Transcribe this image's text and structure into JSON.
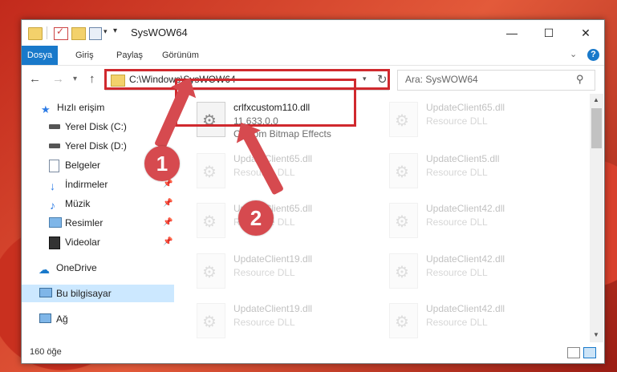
{
  "window": {
    "title": "SysWOW64",
    "min": "—",
    "max": "☐",
    "close": "✕"
  },
  "colors": {
    "accent": "#1979ca",
    "highlight": "#d0292e",
    "arrow": "#d64a4f",
    "selected": "#cce8ff"
  },
  "ribbon": {
    "tabs": [
      "Dosya",
      "Giriş",
      "Paylaş",
      "Görünüm"
    ],
    "help": "?"
  },
  "address": {
    "path": "C:\\Windows\\SysWOW64",
    "search_placeholder": "Ara: SysWOW64"
  },
  "nav": {
    "items": [
      {
        "label": "Hızlı erişim",
        "icon": "star-icon"
      },
      {
        "label": "Yerel Disk (C:)",
        "icon": "drive-icon"
      },
      {
        "label": "Yerel Disk (D:)",
        "icon": "drive-icon"
      },
      {
        "label": "Belgeler",
        "icon": "documents-icon"
      },
      {
        "label": "İndirmeler",
        "icon": "download-icon"
      },
      {
        "label": "Müzik",
        "icon": "music-icon"
      },
      {
        "label": "Resimler",
        "icon": "pictures-icon"
      },
      {
        "label": "Videolar",
        "icon": "video-icon"
      },
      {
        "label": "OneDrive",
        "icon": "cloud-icon"
      },
      {
        "label": "Bu bilgisayar",
        "icon": "computer-icon"
      },
      {
        "label": "Ağ",
        "icon": "network-icon"
      }
    ]
  },
  "files": {
    "highlighted": {
      "name": "crlfxcustom110.dll",
      "version": "11.633.0.0",
      "desc": "Custom Bitmap Effects"
    },
    "left": [
      {
        "name": "UpdateClient65.dll",
        "desc": "Resource DLL"
      },
      {
        "name": "UpdateClient65.dll",
        "desc": "Resource DLL"
      },
      {
        "name": "UpdateClient19.dll",
        "desc": "Resource DLL"
      },
      {
        "name": "UpdateClient19.dll",
        "desc": "Resource DLL"
      }
    ],
    "right": [
      {
        "name": "UpdateClient65.dll",
        "desc": "Resource DLL"
      },
      {
        "name": "UpdateClient5.dll",
        "desc": "Resource DLL"
      },
      {
        "name": "UpdateClient42.dll",
        "desc": "Resource DLL"
      },
      {
        "name": "UpdateClient42.dll",
        "desc": "Resource DLL"
      },
      {
        "name": "UpdateClient42.dll",
        "desc": "Resource DLL"
      },
      {
        "name": "UpdateClient42.dll",
        "desc": "Resource DLL"
      }
    ]
  },
  "status": {
    "count": "160 öğe"
  },
  "annotations": {
    "step1": "1",
    "step2": "2"
  }
}
